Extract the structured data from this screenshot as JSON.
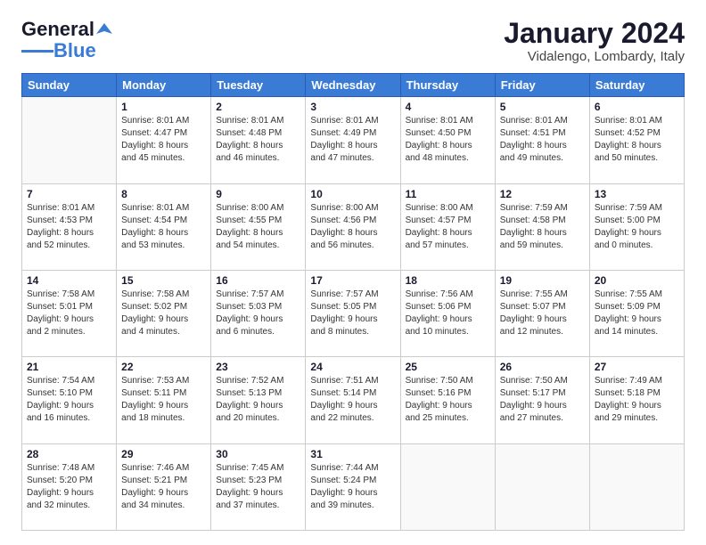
{
  "logo": {
    "line1": "General",
    "line2": "Blue"
  },
  "title": "January 2024",
  "subtitle": "Vidalengo, Lombardy, Italy",
  "days_header": [
    "Sunday",
    "Monday",
    "Tuesday",
    "Wednesday",
    "Thursday",
    "Friday",
    "Saturday"
  ],
  "weeks": [
    [
      {
        "num": "",
        "info": ""
      },
      {
        "num": "1",
        "info": "Sunrise: 8:01 AM\nSunset: 4:47 PM\nDaylight: 8 hours\nand 45 minutes."
      },
      {
        "num": "2",
        "info": "Sunrise: 8:01 AM\nSunset: 4:48 PM\nDaylight: 8 hours\nand 46 minutes."
      },
      {
        "num": "3",
        "info": "Sunrise: 8:01 AM\nSunset: 4:49 PM\nDaylight: 8 hours\nand 47 minutes."
      },
      {
        "num": "4",
        "info": "Sunrise: 8:01 AM\nSunset: 4:50 PM\nDaylight: 8 hours\nand 48 minutes."
      },
      {
        "num": "5",
        "info": "Sunrise: 8:01 AM\nSunset: 4:51 PM\nDaylight: 8 hours\nand 49 minutes."
      },
      {
        "num": "6",
        "info": "Sunrise: 8:01 AM\nSunset: 4:52 PM\nDaylight: 8 hours\nand 50 minutes."
      }
    ],
    [
      {
        "num": "7",
        "info": "Sunrise: 8:01 AM\nSunset: 4:53 PM\nDaylight: 8 hours\nand 52 minutes."
      },
      {
        "num": "8",
        "info": "Sunrise: 8:01 AM\nSunset: 4:54 PM\nDaylight: 8 hours\nand 53 minutes."
      },
      {
        "num": "9",
        "info": "Sunrise: 8:00 AM\nSunset: 4:55 PM\nDaylight: 8 hours\nand 54 minutes."
      },
      {
        "num": "10",
        "info": "Sunrise: 8:00 AM\nSunset: 4:56 PM\nDaylight: 8 hours\nand 56 minutes."
      },
      {
        "num": "11",
        "info": "Sunrise: 8:00 AM\nSunset: 4:57 PM\nDaylight: 8 hours\nand 57 minutes."
      },
      {
        "num": "12",
        "info": "Sunrise: 7:59 AM\nSunset: 4:58 PM\nDaylight: 8 hours\nand 59 minutes."
      },
      {
        "num": "13",
        "info": "Sunrise: 7:59 AM\nSunset: 5:00 PM\nDaylight: 9 hours\nand 0 minutes."
      }
    ],
    [
      {
        "num": "14",
        "info": "Sunrise: 7:58 AM\nSunset: 5:01 PM\nDaylight: 9 hours\nand 2 minutes."
      },
      {
        "num": "15",
        "info": "Sunrise: 7:58 AM\nSunset: 5:02 PM\nDaylight: 9 hours\nand 4 minutes."
      },
      {
        "num": "16",
        "info": "Sunrise: 7:57 AM\nSunset: 5:03 PM\nDaylight: 9 hours\nand 6 minutes."
      },
      {
        "num": "17",
        "info": "Sunrise: 7:57 AM\nSunset: 5:05 PM\nDaylight: 9 hours\nand 8 minutes."
      },
      {
        "num": "18",
        "info": "Sunrise: 7:56 AM\nSunset: 5:06 PM\nDaylight: 9 hours\nand 10 minutes."
      },
      {
        "num": "19",
        "info": "Sunrise: 7:55 AM\nSunset: 5:07 PM\nDaylight: 9 hours\nand 12 minutes."
      },
      {
        "num": "20",
        "info": "Sunrise: 7:55 AM\nSunset: 5:09 PM\nDaylight: 9 hours\nand 14 minutes."
      }
    ],
    [
      {
        "num": "21",
        "info": "Sunrise: 7:54 AM\nSunset: 5:10 PM\nDaylight: 9 hours\nand 16 minutes."
      },
      {
        "num": "22",
        "info": "Sunrise: 7:53 AM\nSunset: 5:11 PM\nDaylight: 9 hours\nand 18 minutes."
      },
      {
        "num": "23",
        "info": "Sunrise: 7:52 AM\nSunset: 5:13 PM\nDaylight: 9 hours\nand 20 minutes."
      },
      {
        "num": "24",
        "info": "Sunrise: 7:51 AM\nSunset: 5:14 PM\nDaylight: 9 hours\nand 22 minutes."
      },
      {
        "num": "25",
        "info": "Sunrise: 7:50 AM\nSunset: 5:16 PM\nDaylight: 9 hours\nand 25 minutes."
      },
      {
        "num": "26",
        "info": "Sunrise: 7:50 AM\nSunset: 5:17 PM\nDaylight: 9 hours\nand 27 minutes."
      },
      {
        "num": "27",
        "info": "Sunrise: 7:49 AM\nSunset: 5:18 PM\nDaylight: 9 hours\nand 29 minutes."
      }
    ],
    [
      {
        "num": "28",
        "info": "Sunrise: 7:48 AM\nSunset: 5:20 PM\nDaylight: 9 hours\nand 32 minutes."
      },
      {
        "num": "29",
        "info": "Sunrise: 7:46 AM\nSunset: 5:21 PM\nDaylight: 9 hours\nand 34 minutes."
      },
      {
        "num": "30",
        "info": "Sunrise: 7:45 AM\nSunset: 5:23 PM\nDaylight: 9 hours\nand 37 minutes."
      },
      {
        "num": "31",
        "info": "Sunrise: 7:44 AM\nSunset: 5:24 PM\nDaylight: 9 hours\nand 39 minutes."
      },
      {
        "num": "",
        "info": ""
      },
      {
        "num": "",
        "info": ""
      },
      {
        "num": "",
        "info": ""
      }
    ]
  ]
}
